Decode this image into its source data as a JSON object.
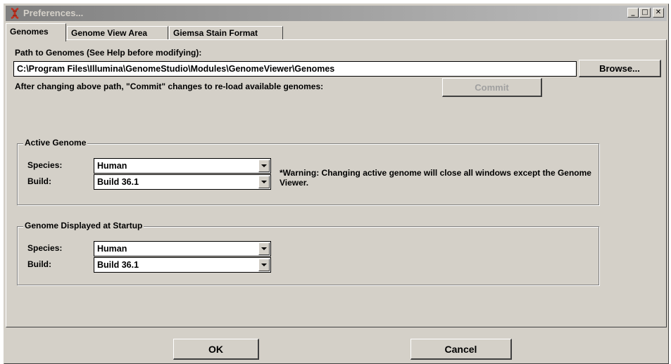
{
  "window": {
    "title": "Preferences...",
    "minimize": "_",
    "maximize": "□",
    "close": "✕"
  },
  "tabs": [
    {
      "label": "Genomes",
      "active": true
    },
    {
      "label": "Genome View Area",
      "active": false
    },
    {
      "label": "Giemsa Stain Format",
      "active": false
    }
  ],
  "genomes": {
    "path_label": "Path to Genomes (See Help before modifying):",
    "path_value": "C:\\Program Files\\Illumina\\GenomeStudio\\Modules\\GenomeViewer\\Genomes",
    "browse_label": "Browse...",
    "commit_hint": "After changing above path, \"Commit\" changes to re-load available genomes:",
    "commit_label": "Commit"
  },
  "active_genome": {
    "legend": "Active Genome",
    "species_label": "Species:",
    "species_value": "Human",
    "build_label": "Build:",
    "build_value": "Build 36.1",
    "warning": "*Warning: Changing active genome will close all windows except the Genome Viewer."
  },
  "startup_genome": {
    "legend": "Genome Displayed at Startup",
    "species_label": "Species:",
    "species_value": "Human",
    "build_label": "Build:",
    "build_value": "Build 36.1"
  },
  "footer": {
    "ok_label": "OK",
    "cancel_label": "Cancel"
  },
  "icons": {
    "app": "genome-app-icon",
    "dropdown": "chevron-down-icon"
  },
  "colors": {
    "face": "#d4d0c8",
    "title_gradient_start": "#808080",
    "title_gradient_end": "#c0c0c0",
    "disabled_text": "#a0a0a0"
  }
}
